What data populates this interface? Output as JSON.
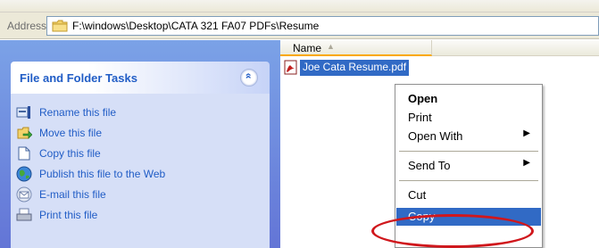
{
  "address": {
    "label": "Address",
    "path": "F:\\windows\\Desktop\\CATA 321 FA07 PDFs\\Resume",
    "folder_icon": "folder-icon"
  },
  "task_pane": {
    "title": "File and Folder Tasks",
    "collapse_glyph": "»",
    "items": [
      {
        "label": "Rename this file",
        "icon": "rename-icon"
      },
      {
        "label": "Move this file",
        "icon": "move-icon"
      },
      {
        "label": "Copy this file",
        "icon": "copy-icon"
      },
      {
        "label": "Publish this file to the Web",
        "icon": "globe-icon"
      },
      {
        "label": "E-mail this file",
        "icon": "email-icon"
      },
      {
        "label": "Print this file",
        "icon": "print-icon"
      }
    ]
  },
  "file_view": {
    "column_name": "Name",
    "sort_glyph": "▲",
    "selected_file": "Joe Cata Resume.pdf"
  },
  "context_menu": {
    "open": "Open",
    "print": "Print",
    "open_with": "Open With",
    "send_to": "Send To",
    "cut": "Cut",
    "copy": "Copy",
    "submenu_glyph": "▶"
  },
  "colors": {
    "selection": "#316ac5",
    "task_link": "#215dc6",
    "highlight_ring": "#d0171c"
  }
}
